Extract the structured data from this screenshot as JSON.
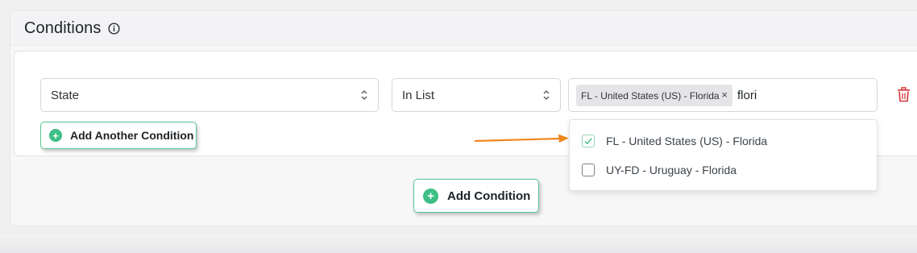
{
  "panel": {
    "title": "Conditions",
    "info_icon": "info-circle-icon"
  },
  "condition": {
    "field_select": {
      "value": "State",
      "icon": "chevron-up-down-icon"
    },
    "operator_select": {
      "value": "In List",
      "icon": "chevron-up-down-icon"
    },
    "values_input": {
      "tags": [
        {
          "label": "FL - United States (US) - Florida",
          "remove": "×"
        }
      ],
      "typed_text": "flori"
    },
    "delete_icon": "trash-icon",
    "add_another_label": "Add Another Condition"
  },
  "dropdown": {
    "options": [
      {
        "label": "FL - United States (US) - Florida",
        "checked": true
      },
      {
        "label": "UY-FD - Uruguay - Florida",
        "checked": false
      }
    ]
  },
  "add_condition_label": "Add Condition",
  "annotation": {
    "icon": "arrow-right-icon",
    "color": "#f0871e"
  },
  "colors": {
    "accent": "#3dbf86",
    "danger": "#d63638"
  }
}
